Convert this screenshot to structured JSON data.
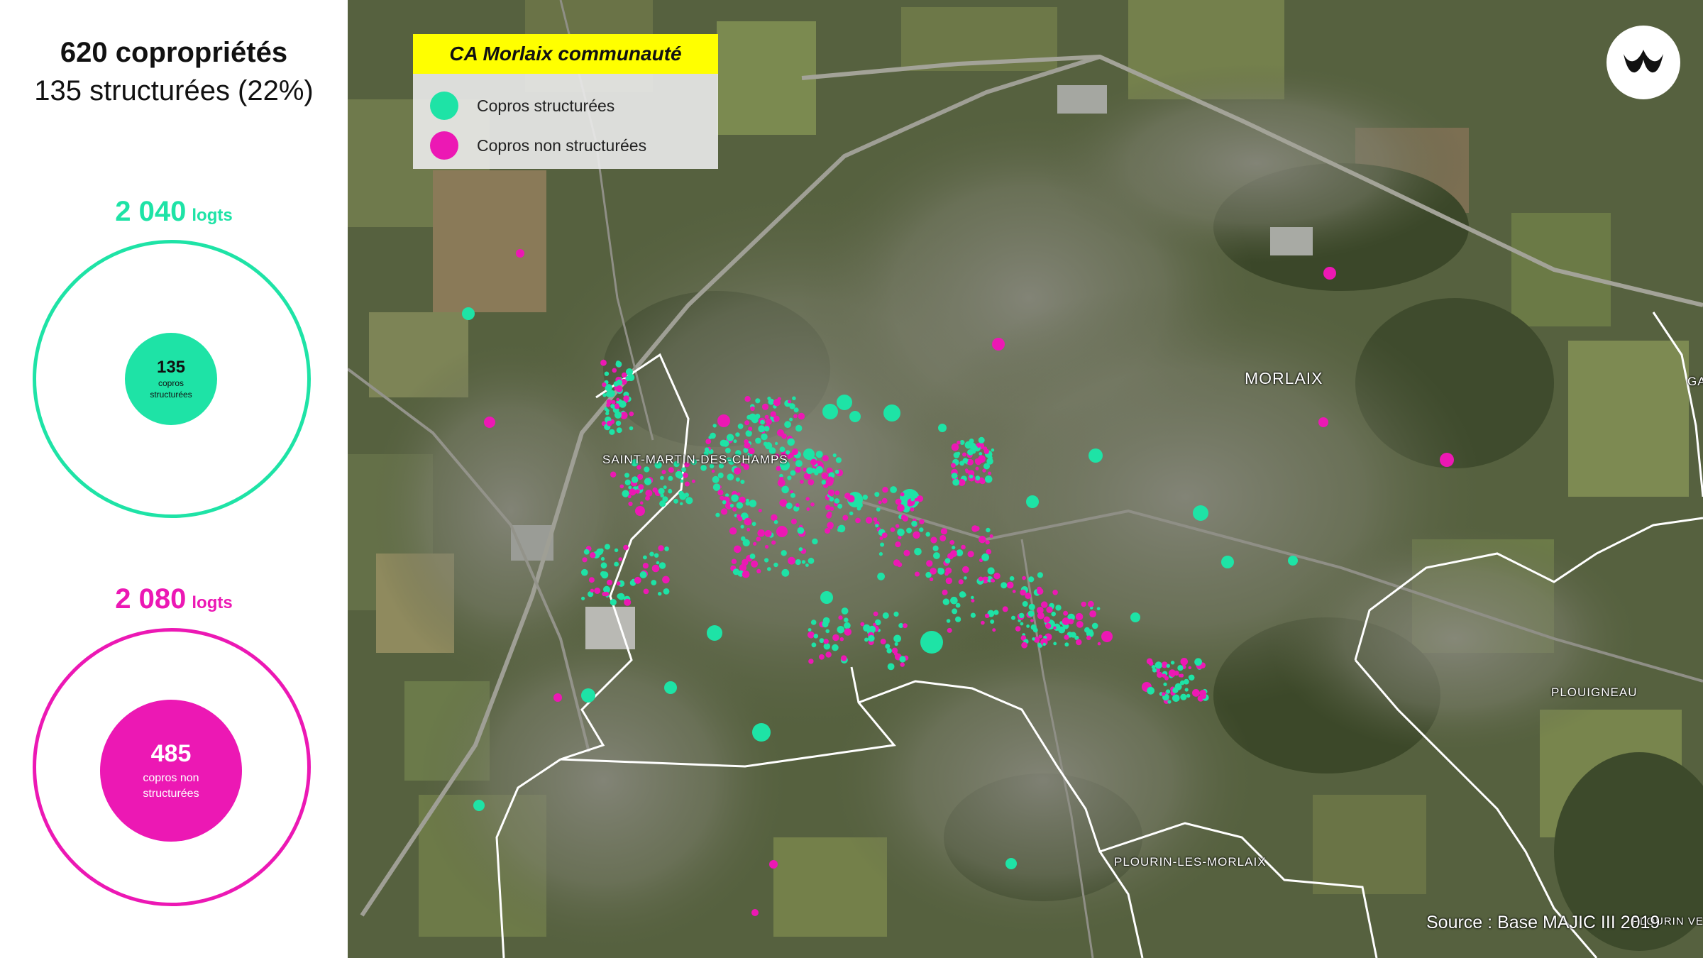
{
  "colors": {
    "structured": "#1ee3a6",
    "non_structured": "#ec18b4"
  },
  "summary": {
    "title": "620 copropriétés",
    "subtitle": "135 structurées (22%)"
  },
  "structured": {
    "logements_value": "2 040",
    "logements_unit": "logts",
    "count": "135",
    "count_label": "copros structurées"
  },
  "non_structured": {
    "logements_value": "2 080",
    "logements_unit": "logts",
    "count": "485",
    "count_label": "copros non structurées"
  },
  "map": {
    "legend": {
      "title": "CA Morlaix communauté",
      "items": [
        {
          "label": "Copros structurées",
          "color": "#1ee3a6"
        },
        {
          "label": "Copros non structurées",
          "color": "#ec18b4"
        }
      ]
    },
    "places": {
      "morlaix": "MORLAIX",
      "saint_martin": "SAINT-MARTIN-DES-CHAMPS",
      "plourin": "PLOURIN-LES-MORLAIX",
      "plouigneau": "PLOUIGNEAU",
      "edge_right": "GA",
      "edge_bottom": "PLOURIN VEN"
    },
    "source": "Source : Base MAJIC III 2019",
    "logo_icon": "brand-logo-icon"
  }
}
